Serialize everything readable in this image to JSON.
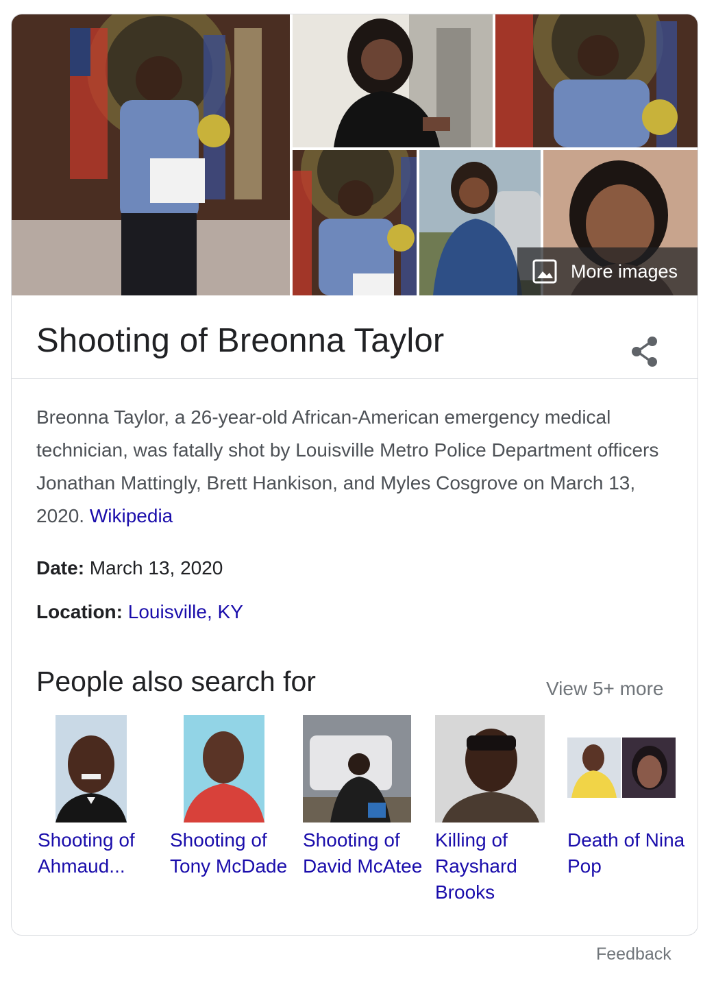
{
  "collage": {
    "more_images_label": "More images",
    "icon": "image-icon"
  },
  "entity": {
    "title": "Shooting of Breonna Taylor",
    "share_icon": "share-icon"
  },
  "description": {
    "text": "Breonna Taylor, a 26-year-old African-American emergency medical technician, was fatally shot by Louisville Metro Police Department officers Jonathan Mattingly, Brett Hankison, and Myles Cosgrove on March 13, 2020. ",
    "source_link": "Wikipedia"
  },
  "facts": {
    "date_label": "Date:",
    "date_value": " March 13, 2020",
    "location_label": "Location:",
    "location_value": "Louisville, KY"
  },
  "people_also_search": {
    "title": "People also search for",
    "view_more": "View 5+ more",
    "items": [
      {
        "label": "Shooting of Ahmaud..."
      },
      {
        "label": "Shooting of Tony McDade"
      },
      {
        "label": "Shooting of David McAtee"
      },
      {
        "label": "Killing of Rayshard Brooks"
      },
      {
        "label": "Death of Nina Pop"
      }
    ]
  },
  "footer": {
    "feedback": "Feedback"
  },
  "colors": {
    "link": "#1a0dab",
    "text_primary": "#202124",
    "text_secondary": "#4d5156",
    "muted": "#70757a",
    "border": "#dadce0"
  }
}
